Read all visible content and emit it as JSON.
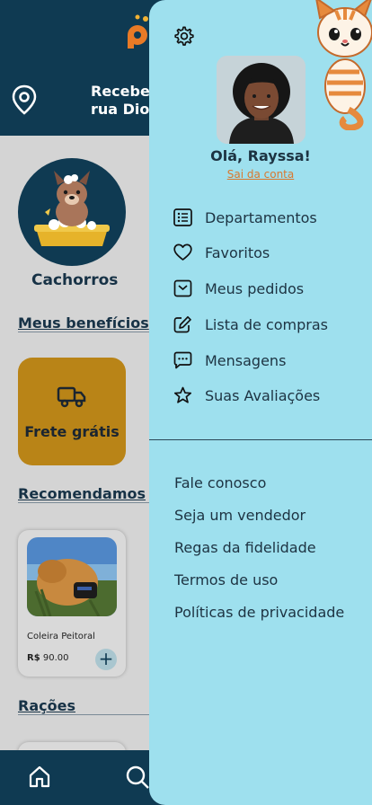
{
  "header": {
    "delivery_line1": "Receber em",
    "delivery_line2": "rua Dionísio"
  },
  "category": {
    "label": "Cachorros"
  },
  "sections": {
    "benefits": "Meus benefícios",
    "recommended": "Recomendamos",
    "rations": "Rações"
  },
  "benefit_card": {
    "label": "Frete grátis"
  },
  "product": {
    "name": "Coleira Peitoral",
    "currency": "R$",
    "price": "90.00",
    "add_label": "+"
  },
  "drawer": {
    "greeting": "Olá, Rayssa!",
    "logout": "Sai da conta",
    "menu": [
      {
        "label": "Departamentos",
        "icon": "list-icon"
      },
      {
        "label": "Favoritos",
        "icon": "heart-icon"
      },
      {
        "label": "Meus pedidos",
        "icon": "inbox-icon"
      },
      {
        "label": "Lista de compras",
        "icon": "edit-icon"
      },
      {
        "label": "Mensagens",
        "icon": "message-icon"
      },
      {
        "label": "Suas Avaliações",
        "icon": "star-icon"
      }
    ],
    "links": [
      "Fale conosco",
      "Seja um vendedor",
      "Regas da fidelidade",
      "Termos de uso",
      "Políticas de privacidade"
    ]
  },
  "colors": {
    "primary_dark": "#0f3a52",
    "drawer_bg": "#9ee0ee",
    "accent_orange": "#d9782e",
    "benefit_gold": "#b98417"
  }
}
